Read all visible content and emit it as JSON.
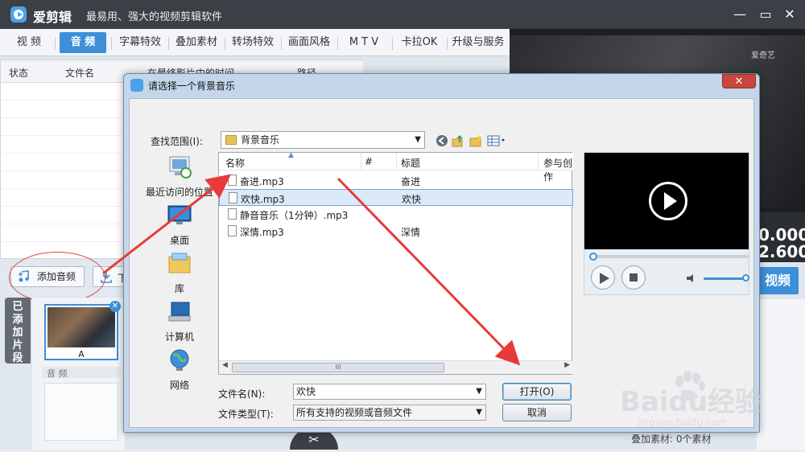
{
  "app": {
    "name": "爱剪辑",
    "slogan": "最易用、强大的视频剪辑软件",
    "window_buttons": [
      "—",
      "▭",
      "✕"
    ]
  },
  "tabs": [
    {
      "label": "视 频"
    },
    {
      "label": "音 频"
    },
    {
      "label": "字幕特效"
    },
    {
      "label": "叠加素材"
    },
    {
      "label": "转场特效"
    },
    {
      "label": "画面风格"
    },
    {
      "label": "M T V"
    },
    {
      "label": "卡拉OK"
    },
    {
      "label": "升级与服务"
    }
  ],
  "active_tab_index": 1,
  "audio_list": {
    "columns": [
      "状态",
      "文件名",
      "在最终影片中的时间",
      "路径"
    ]
  },
  "buttons": {
    "add_audio": "添加音频",
    "download_partial": "下"
  },
  "side_tab": "已添加片段",
  "clip": {
    "label": "A",
    "close": "✕"
  },
  "audio_section_label": "音 频",
  "player": {
    "watermark": "爱奇艺",
    "time1": "0.000",
    "time2": "2.600",
    "export_label": "视频"
  },
  "overlay_label": "叠加素材:   0个素材",
  "dialog": {
    "title": "请选择一个背景音乐",
    "close": "✕",
    "lookin_label": "查找范围(I):",
    "lookin_value": "背景音乐",
    "places": [
      "最近访问的位置",
      "桌面",
      "库",
      "计算机",
      "网络"
    ],
    "columns": [
      "名称",
      "#",
      "标题",
      "参与创作"
    ],
    "files": [
      {
        "name": "奋进.mp3",
        "title": "奋进",
        "selected": false
      },
      {
        "name": "欢快.mp3",
        "title": "欢快",
        "selected": true
      },
      {
        "name": "静音音乐（1分钟）.mp3",
        "title": "",
        "selected": false
      },
      {
        "name": "深情.mp3",
        "title": "深情",
        "selected": false
      }
    ],
    "filename_label": "文件名(N):",
    "filename_value": "欢快",
    "filetype_label": "文件类型(T):",
    "filetype_value": "所有支持的视频或音频文件",
    "open_button": "打开(O)",
    "cancel_button": "取消",
    "scroll_glyph": "III"
  },
  "watermark": {
    "brand": "Baidu经验",
    "url": "jingyan.baidu.com"
  },
  "colors": {
    "accent": "#3d8fd9",
    "annotation_red": "#e83a3a",
    "titlebar": "#3b3f46"
  }
}
